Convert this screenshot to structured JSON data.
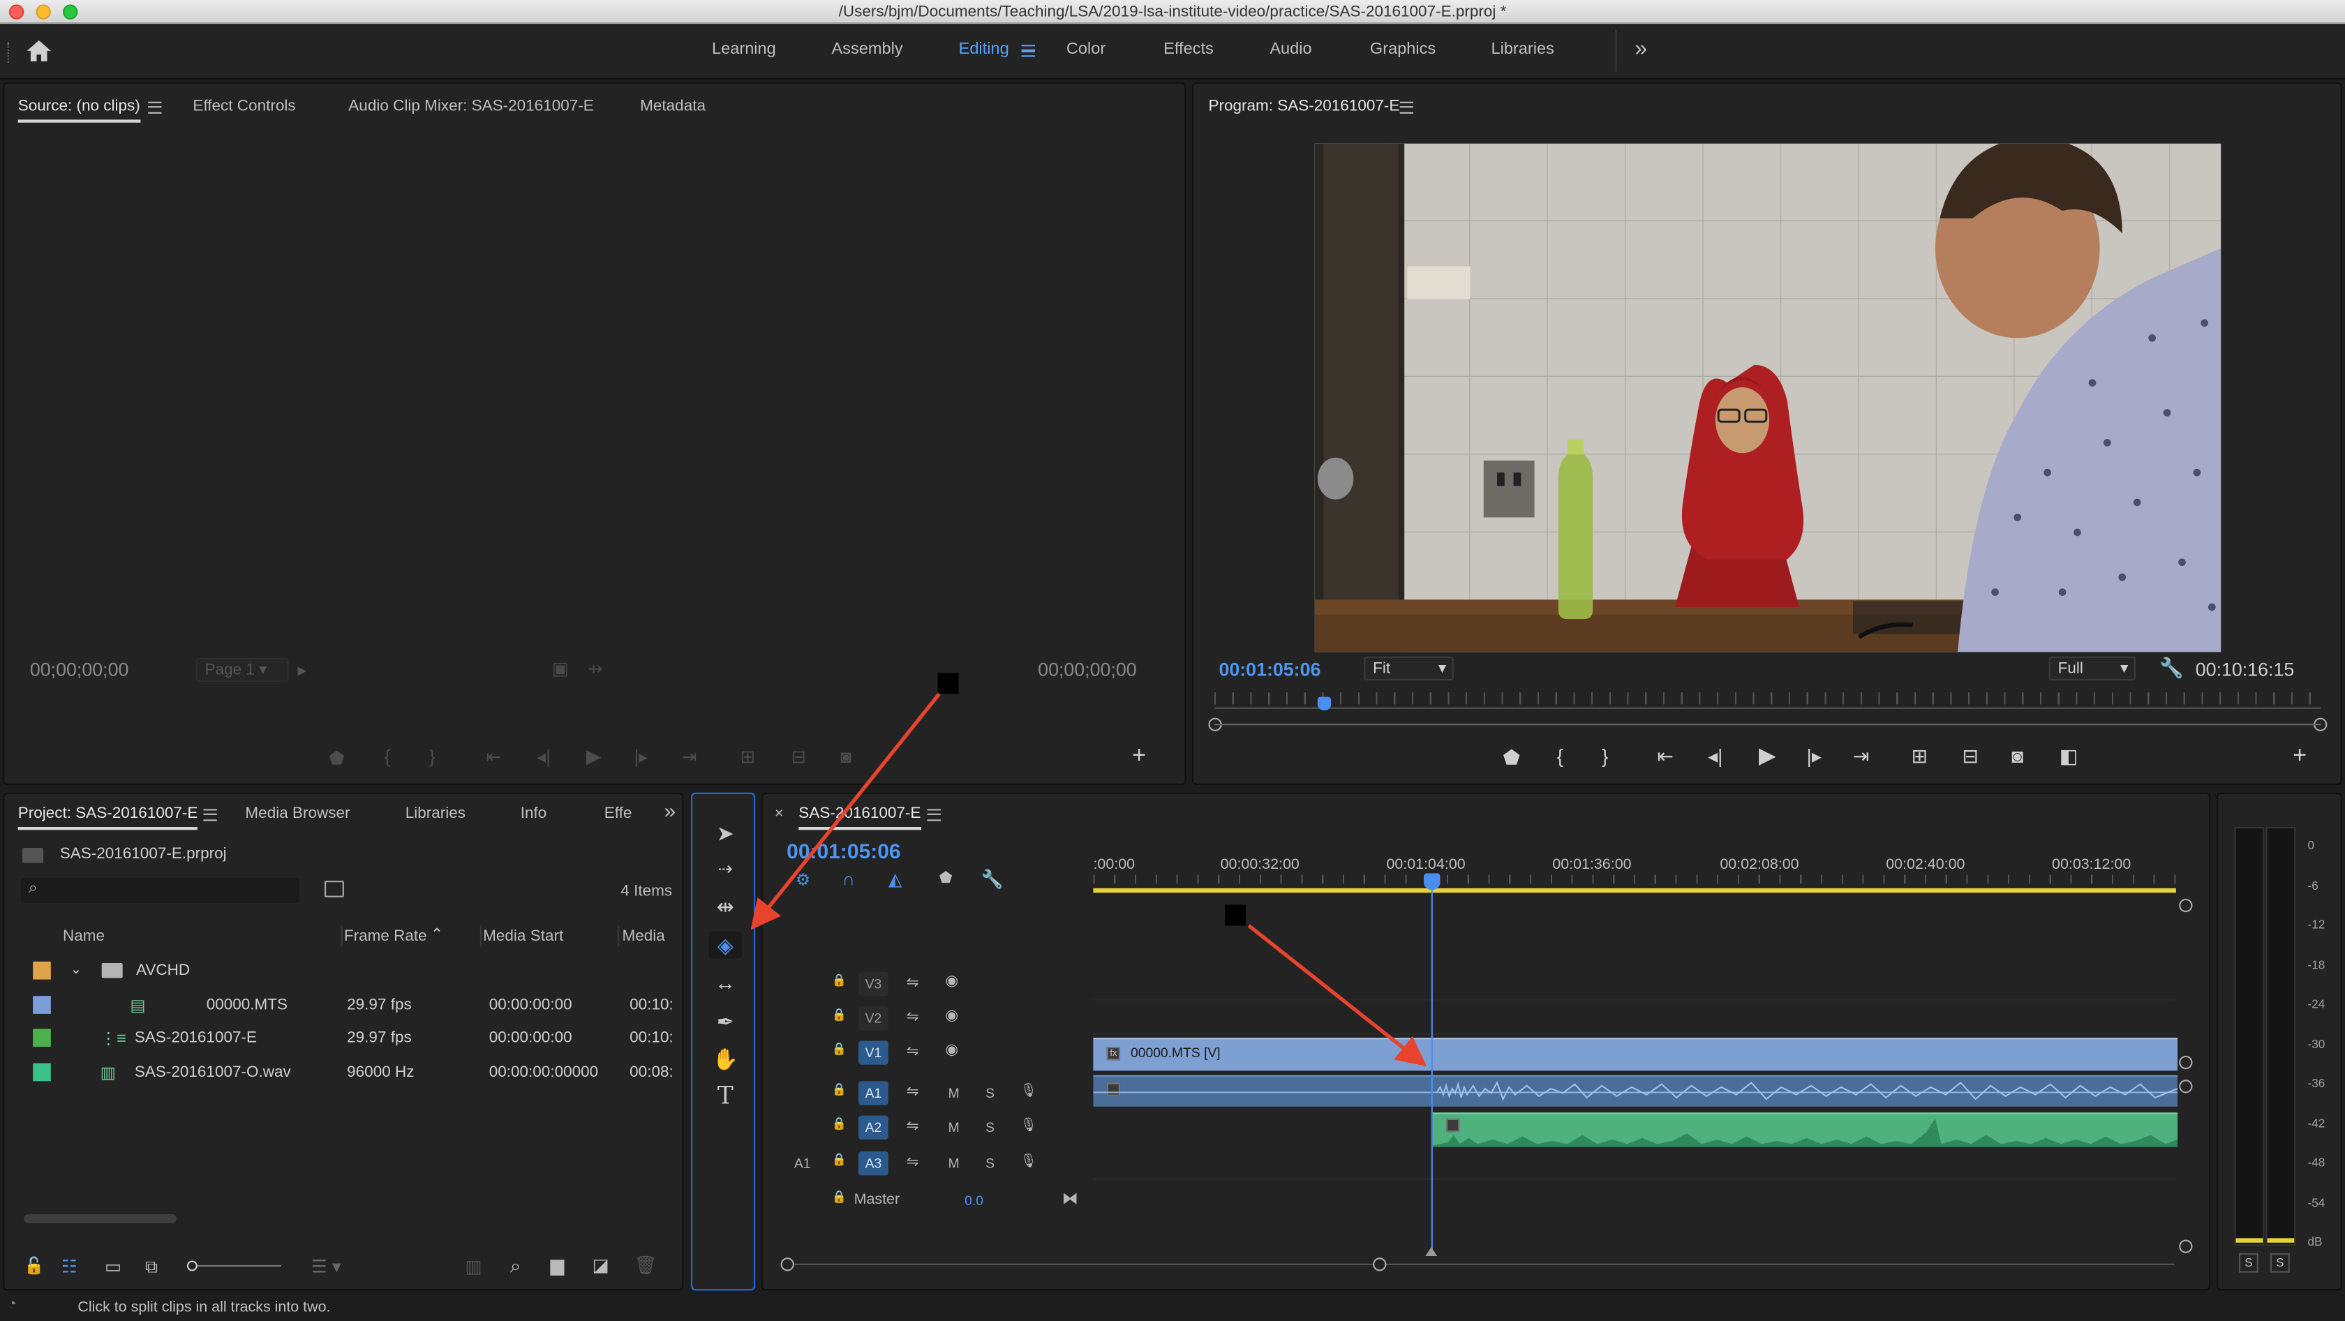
{
  "window": {
    "title": "/Users/bjm/Documents/Teaching/LSA/2019-lsa-institute-video/practice/SAS-20161007-E.prproj *"
  },
  "workspaces": {
    "items": [
      "Learning",
      "Assembly",
      "Editing",
      "Color",
      "Effects",
      "Audio",
      "Graphics",
      "Libraries"
    ],
    "active": "Editing",
    "more": "»"
  },
  "source_panel": {
    "tabs": [
      "Source: (no clips)",
      "Effect Controls",
      "Audio Clip Mixer: SAS-20161007-E",
      "Metadata"
    ],
    "timecode_left": "00;00;00;00",
    "timecode_right": "00;00;00;00",
    "page": "Page 1"
  },
  "program_panel": {
    "title": "Program: SAS-20161007-E",
    "timecode": "00:01:05:06",
    "fit": "Fit",
    "quality": "Full",
    "duration": "00:10:16:15"
  },
  "project_panel": {
    "tabs": [
      "Project: SAS-20161007-E",
      "Media Browser",
      "Libraries",
      "Info",
      "Effe"
    ],
    "filename": "SAS-20161007-E.prproj",
    "item_count": "4 Items",
    "columns": [
      "Name",
      "Frame Rate",
      "Media Start",
      "Media"
    ],
    "rows": [
      {
        "name": "AVCHD",
        "fps": "",
        "start": "",
        "media": "",
        "color": "#e0a24a",
        "indent": 0
      },
      {
        "name": "00000.MTS",
        "fps": "29.97 fps",
        "start": "00:00:00:00",
        "media": "00:10:",
        "color": "#7c9dd6",
        "indent": 2
      },
      {
        "name": "SAS-20161007-E",
        "fps": "29.97 fps",
        "start": "00:00:00:00",
        "media": "00:10:",
        "color": "#4cb04c",
        "indent": 1
      },
      {
        "name": "SAS-20161007-O.wav",
        "fps": "96000 Hz",
        "start": "00:00:00:00000",
        "media": "00:08:",
        "color": "#3cc08a",
        "indent": 1
      }
    ]
  },
  "timeline": {
    "tab": "SAS-20161007-E",
    "timecode": "00:01:05:06",
    "ruler": [
      ":00:00",
      "00:00:32:00",
      "00:01:04:00",
      "00:01:36:00",
      "00:02:08:00",
      "00:02:40:00",
      "00:03:12:00"
    ],
    "tracks": [
      {
        "src": "",
        "name": "V3",
        "type": "video"
      },
      {
        "src": "",
        "name": "V2",
        "type": "video"
      },
      {
        "src": "",
        "name": "V1",
        "type": "video"
      },
      {
        "src": "",
        "name": "A1",
        "type": "audio"
      },
      {
        "src": "",
        "name": "A2",
        "type": "audio"
      },
      {
        "src": "A1",
        "name": "A3",
        "type": "audio"
      }
    ],
    "master_label": "Master",
    "master_value": "0.0",
    "clip_v1": "00000.MTS [V]",
    "mute": "M",
    "solo": "S"
  },
  "audio_meter": {
    "scale": [
      "0",
      "-6",
      "-12",
      "-18",
      "-24",
      "-30",
      "-36",
      "-42",
      "-48",
      "-54",
      "dB"
    ],
    "solo": "S"
  },
  "status_bar": {
    "text": "Click to split clips in all tracks into two."
  },
  "icons": [
    "home-icon",
    "hamburger-menu-icon",
    "selection-tool-icon",
    "track-select-tool-icon",
    "ripple-edit-tool-icon",
    "razor-tool-icon",
    "slip-tool-icon",
    "pen-tool-icon",
    "hand-tool-icon",
    "type-tool-icon",
    "wrench-icon",
    "play-icon",
    "camera-icon"
  ],
  "colors": {
    "accent": "#4a8ff0",
    "tool_highlight": "#1f6ed6",
    "annotation_arrow": "#e8432c",
    "video_clip": "#7d9fd2",
    "audio_clip": "#4fb17e"
  }
}
